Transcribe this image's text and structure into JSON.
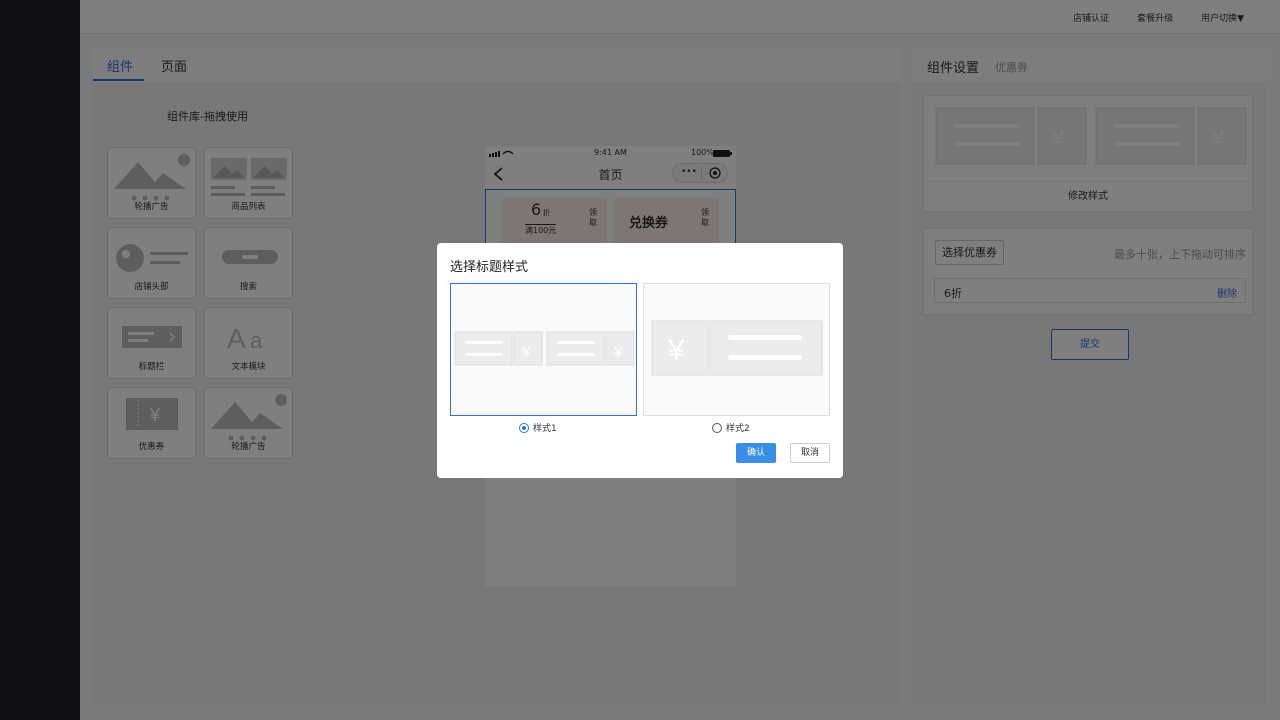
{
  "topbar": {
    "links": [
      "店铺认证",
      "套餐升级",
      "用户切换▼"
    ]
  },
  "left": {
    "tabs": [
      {
        "label": "组件"
      },
      {
        "label": "页面"
      }
    ],
    "library_title": "组件库-拖拽使用",
    "components": [
      {
        "label": "轮播广告",
        "icon": "image-carousel-icon"
      },
      {
        "label": "商品列表",
        "icon": "product-list-icon"
      },
      {
        "label": "店铺头部",
        "icon": "shop-header-icon"
      },
      {
        "label": "搜索",
        "icon": "search-bar-icon"
      },
      {
        "label": "标题栏",
        "icon": "title-bar-icon"
      },
      {
        "label": "文本模块",
        "icon": "text-module-icon"
      },
      {
        "label": "优惠券",
        "icon": "coupon-icon"
      },
      {
        "label": "轮播广告",
        "icon": "image-carousel-icon"
      }
    ]
  },
  "phone": {
    "time": "9:41 AM",
    "battery": "100%",
    "title": "首页",
    "coupon1": {
      "amount": "6",
      "unit": "折",
      "condition": "满100元",
      "action": "领取"
    },
    "coupon2": {
      "label": "兑换券",
      "action": "领取"
    }
  },
  "right": {
    "title": "组件设置",
    "subtitle": "优惠券",
    "modify_label": "修改样式",
    "select_button": "选择优惠券",
    "hint": "最多十张，上下拖动可排序",
    "coupons": [
      {
        "name": "6折",
        "action": "删除"
      }
    ],
    "submit": "提交"
  },
  "modal": {
    "title": "选择标题样式",
    "options": [
      {
        "label": "样式1",
        "selected": true
      },
      {
        "label": "样式2",
        "selected": false
      }
    ],
    "confirm": "确认",
    "cancel": "取消"
  },
  "colors": {
    "accent": "#2f6fe0",
    "confirm": "#3a8ee6",
    "sidebar": "#1e1f2b"
  }
}
